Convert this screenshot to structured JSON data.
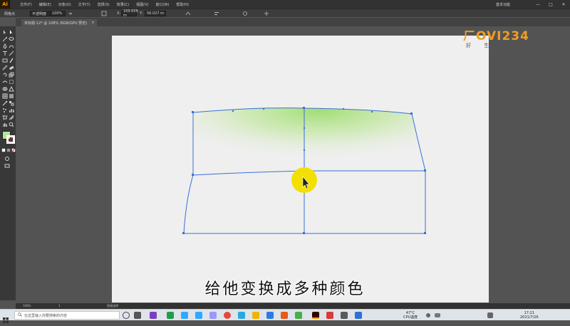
{
  "menubar": {
    "app_logo": "Ai",
    "items": [
      "文件(F)",
      "编辑(E)",
      "对象(O)",
      "文字(T)",
      "选择(S)",
      "效果(C)",
      "视图(V)",
      "窗口(W)",
      "帮助(H)"
    ],
    "workspace": "基本功能",
    "win_min": "—",
    "win_max": "□",
    "win_close": "✕"
  },
  "controlbar": {
    "selection_label": "网格点",
    "opacity_label": "不透明度",
    "opacity_value": "100%",
    "x_label": "X:",
    "x_value": "169.656 m",
    "y_label": "Y:",
    "y_value": "56.027 m"
  },
  "tab": {
    "title": "未标题-12* @ 108% (RGB/GPU 预览)",
    "close": "×"
  },
  "watermark": {
    "logo": "ㄏOVI234",
    "sub": "好 生 活 好 二 百"
  },
  "subtitle": "给他变换成多种颜色",
  "statusbar": {
    "zoom": "108%",
    "page": "1",
    "tool": "直接选择"
  },
  "taskbar": {
    "search_placeholder": "在这里输入你要搜索的内容",
    "weather_temp": "47°C",
    "weather_label": "CPU温度",
    "time": "17:21",
    "date": "2021/7/26"
  },
  "colors": {
    "path_stroke": "#3b6fd6",
    "gradient_green": "#9fdd6d",
    "fill_swatch": "#b7e39a",
    "cursor_highlight": "#f2e000"
  }
}
